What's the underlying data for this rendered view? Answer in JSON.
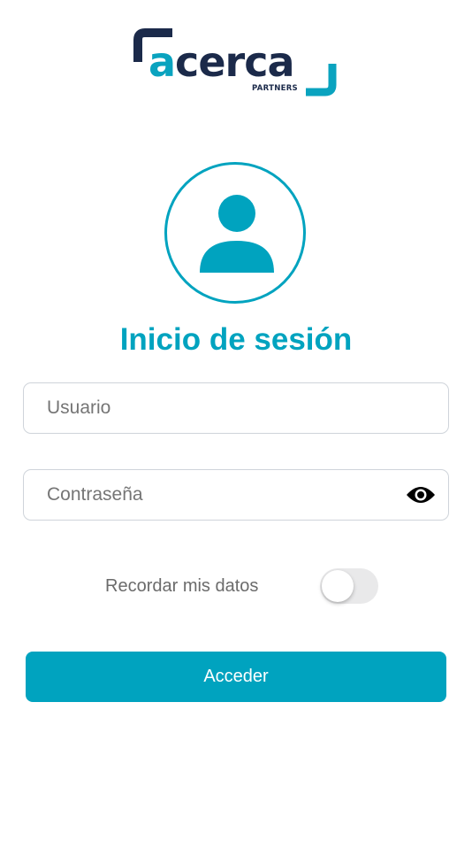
{
  "logo": {
    "word_first": "a",
    "word_rest": "cerca",
    "subtitle": "PARTNERS",
    "icon": "acerca-logo"
  },
  "login": {
    "title": "Inicio de sesión",
    "avatar_icon": "user-icon",
    "username": {
      "value": "",
      "placeholder": "Usuario"
    },
    "password": {
      "value": "",
      "placeholder": "Contraseña",
      "visibility_icon": "eye-icon"
    },
    "remember": {
      "label": "Recordar mis datos",
      "enabled": false
    },
    "submit_label": "Acceder"
  },
  "colors": {
    "accent": "#00a3bf",
    "logo_navy": "#1b2a4a",
    "toggle_off": "#e9e9ea",
    "field_border": "#cfd4da",
    "placeholder_text": "#757575"
  }
}
